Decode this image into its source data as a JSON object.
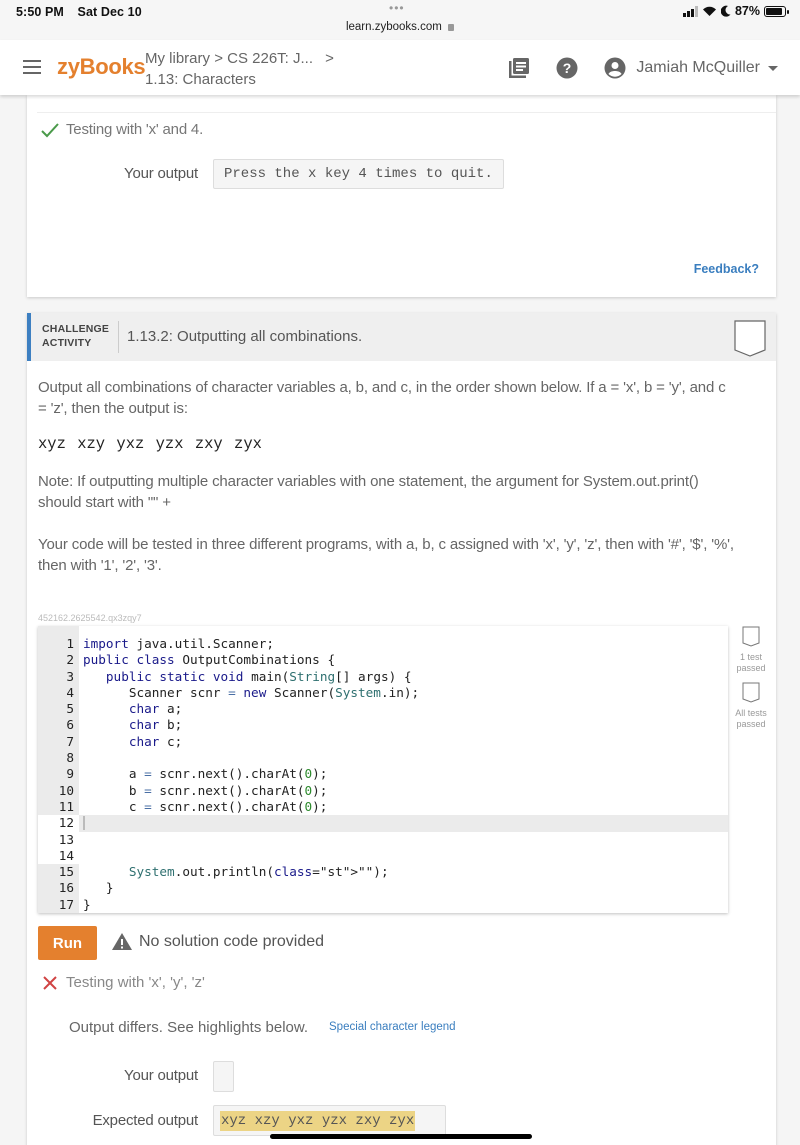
{
  "status_bar": {
    "time": "5:50 PM",
    "date": "Sat Dec 10",
    "url": "learn.zybooks.com",
    "battery_percent": "87%",
    "battery_level": 0.87,
    "icons": [
      "signal-icon",
      "wifi-icon",
      "moon-icon",
      "battery-icon"
    ]
  },
  "header": {
    "logo": "zyBooks",
    "breadcrumb": {
      "line1": [
        "My library",
        ">",
        "CS 226T: J...",
        ">"
      ],
      "line2": "1.13: Characters"
    },
    "icons": [
      "library-icon",
      "help-icon",
      "account-icon"
    ],
    "user_name": "Jamiah McQuiller",
    "brand_color": "#e4802e"
  },
  "previous_activity": {
    "test_label": "Testing with 'x' and 4.",
    "test_status": "passed",
    "your_output_label": "Your output",
    "your_output": "Press the x key 4 times to quit.",
    "feedback_link": "Feedback?"
  },
  "challenge": {
    "kind_line1": "CHALLENGE",
    "kind_line2": "ACTIVITY",
    "title": "1.13.2: Outputting all combinations.",
    "accent_color": "#3d7fc1",
    "prompt_p1": "Output all combinations of character variables a, b, and c, in the order shown below. If a = 'x', b = 'y', and c = 'z', then the output is:",
    "combinations": "xyz xzy yxz yzx zxy zyx",
    "prompt_p2": "Note: If outputting multiple character variables with one statement, the argument for System.out.print() should start with \"\" +",
    "prompt_p3": "Your code will be tested in three different programs, with a, b, c assigned with 'x', 'y', 'z', then with '#', '$', '%', then with '1', '2', '3'.",
    "activity_id": "452162.2625542.qx3zqy7",
    "code_lines": [
      {
        "n": "1",
        "text": "import java.util.Scanner;"
      },
      {
        "n": "2",
        "text": "public class OutputCombinations {"
      },
      {
        "n": "3",
        "text": "   public static void main(String[] args) {"
      },
      {
        "n": "4",
        "text": "      Scanner scnr = new Scanner(System.in);"
      },
      {
        "n": "5",
        "text": "      char a;"
      },
      {
        "n": "6",
        "text": "      char b;"
      },
      {
        "n": "7",
        "text": "      char c;"
      },
      {
        "n": "8",
        "text": ""
      },
      {
        "n": "9",
        "text": "      a = scnr.next().charAt(0);"
      },
      {
        "n": "10",
        "text": "      b = scnr.next().charAt(0);"
      },
      {
        "n": "11",
        "text": "      c = scnr.next().charAt(0);"
      },
      {
        "n": "12",
        "text": ""
      },
      {
        "n": "13",
        "text": ""
      },
      {
        "n": "14",
        "text": ""
      },
      {
        "n": "15",
        "text": "      System.out.println(\"\");"
      },
      {
        "n": "16",
        "text": "   }"
      },
      {
        "n": "17",
        "text": "}"
      }
    ],
    "active_line": "12",
    "test_badges": [
      {
        "label": "1 test passed",
        "line1": "1 test",
        "line2": "passed"
      },
      {
        "label": "All tests passed",
        "line1": "All tests",
        "line2": "passed"
      }
    ],
    "run_label": "Run",
    "warning_text": "No solution code provided",
    "fail_test_label": "Testing with 'x', 'y', 'z'",
    "differs_text": "Output differs. See highlights below.",
    "legend_link": "Special character legend",
    "your_output_label": "Your output",
    "your_output": "",
    "expected_output_label": "Expected output",
    "expected_output": "xyz xzy yxz yzx zxy zyx"
  }
}
